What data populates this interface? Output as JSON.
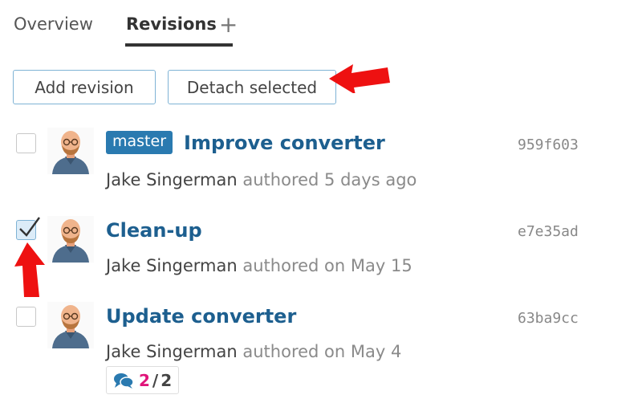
{
  "tabs": {
    "overview": "Overview",
    "revisions": "Revisions",
    "add": "+"
  },
  "buttons": {
    "add_revision": "Add revision",
    "detach_selected": "Detach selected"
  },
  "revisions": [
    {
      "checked": false,
      "badge": "master",
      "title": "Improve converter",
      "hash": "959f603",
      "author": "Jake Singerman",
      "meta": " authored 5 days ago"
    },
    {
      "checked": true,
      "badge": "",
      "title": "Clean-up",
      "hash": "e7e35ad",
      "author": "Jake Singerman",
      "meta": " authored on May 15"
    },
    {
      "checked": false,
      "badge": "",
      "title": "Update converter",
      "hash": "63ba9cc",
      "author": "Jake Singerman",
      "meta": " authored on May 4",
      "comments": {
        "resolved": "2",
        "separator": "/",
        "total": "2"
      }
    }
  ],
  "colors": {
    "accent": "#2a7ab0",
    "link": "#1d5f8f",
    "comment_count": "#e0157a",
    "annotation_arrow": "#ee1111"
  }
}
